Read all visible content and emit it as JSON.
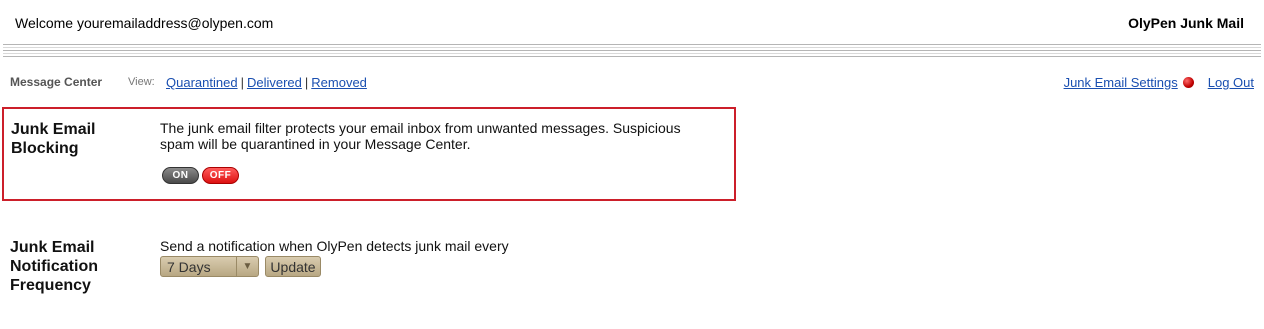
{
  "header": {
    "welcome": "Welcome youremailaddress@olypen.com",
    "brand": "OlyPen Junk Mail"
  },
  "nav": {
    "title": "Message Center",
    "view_label": "View:",
    "links": [
      "Quarantined",
      "Delivered",
      "Removed"
    ],
    "separator": "|",
    "settings_link": "Junk Email Settings",
    "logout_link": "Log Out"
  },
  "blocking": {
    "title_line1": "Junk Email",
    "title_line2": "Blocking",
    "desc_line1": "The junk email filter protects your email inbox from unwanted messages. Suspicious",
    "desc_line2": "spam will be quarantined in your Message Center.",
    "on_label": "ON",
    "off_label": "OFF",
    "state": "OFF"
  },
  "notification": {
    "title_line1": "Junk Email",
    "title_line2": "Notification",
    "title_line3": "Frequency",
    "desc": "Send a notification when OlyPen detects junk mail every",
    "selected": "7 Days",
    "update_label": "Update"
  },
  "colors": {
    "link": "#1a4fb0",
    "highlight_border": "#cc1f2a",
    "button_bg": "#c9ba97",
    "off_red": "#e31b1b"
  }
}
